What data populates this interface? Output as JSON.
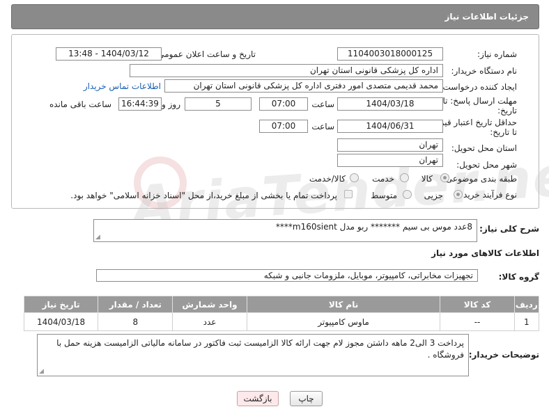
{
  "header": {
    "title": "جزئیات اطلاعات نیاز"
  },
  "form": {
    "need_number_label": "شماره نیاز:",
    "need_number": "1104003018000125",
    "announce_label": "تاریخ و ساعت اعلان عمومی:",
    "announce_value": "1404/03/12 - 13:48",
    "buyer_org_label": "نام دستگاه خریدار:",
    "buyer_org": "اداره کل پزشکی قانونی استان تهران",
    "creator_label": "ایجاد کننده درخواست:",
    "creator": "محمد قدیمی متصدی امور دفتری اداره کل پزشکی قانونی استان تهران",
    "contact_link": "اطلاعات تماس خریدار",
    "deadline_label_1": "مهلت ارسال پاسخ: تا",
    "deadline_label_2": "تاریخ:",
    "deadline_date": "1404/03/18",
    "time_label": "ساعت",
    "deadline_time": "07:00",
    "days_value": "5",
    "days_label": "روز و",
    "remaining_time": "16:44:39",
    "remaining_label": "ساعت باقی مانده",
    "validity_label_1": "حداقل تاریخ اعتبار قیمت:",
    "validity_label_2": "تا تاریخ:",
    "validity_date": "1404/06/31",
    "validity_time": "07:00",
    "province_label": "استان محل تحویل:",
    "province": "تهران",
    "city_label": "شهر محل تحویل:",
    "city": "تهران",
    "category_label": "طبقه بندی موضوعی:",
    "category_options": [
      "کالا",
      "خدمت",
      "کالا/خدمت"
    ],
    "process_label": "نوع فرآیند خرید :",
    "process_options": [
      "جزیی",
      "متوسط"
    ],
    "payment_note": "پرداخت تمام یا بخشی از مبلغ خرید،از محل \"اسناد خزانه اسلامی\" خواهد بود."
  },
  "summary": {
    "label": "شرح کلی نیاز:",
    "text": "8عدد موس بی سیم  *******  ربو مدل m160sient****"
  },
  "goods": {
    "section_title": "اطلاعات کالاهای مورد نیاز",
    "group_label": "گروه کالا:",
    "group_value": "تجهیزات مخابراتی، کامپیوتر، موبایل، ملزومات جانبی و شبکه",
    "columns": [
      "ردیف",
      "کد کالا",
      "نام کالا",
      "واحد شمارش",
      "تعداد / مقدار",
      "تاریخ نیاز"
    ],
    "rows": [
      {
        "row": "1",
        "code": "--",
        "name": "ماوس کامپیوتر",
        "unit": "عدد",
        "qty": "8",
        "date": "1404/03/18"
      }
    ]
  },
  "buyer_notes": {
    "label": "توضیحات خریدار:",
    "text": "پرداخت 3 الی2 ماهه  داشتن مجوز لام جهت ارائه کالا الزامیست  ثبت فاکتور در سامانه مالیاتی الزامیست  هزینه حمل با فروشگاه ."
  },
  "buttons": {
    "print": "چاپ",
    "back": "بازگشت"
  },
  "watermark": "AriaTender.neT",
  "colors": {
    "header_bg": "#8a8a8a",
    "link": "#1a5fb4",
    "back_button_bg": "#fde8ea"
  }
}
